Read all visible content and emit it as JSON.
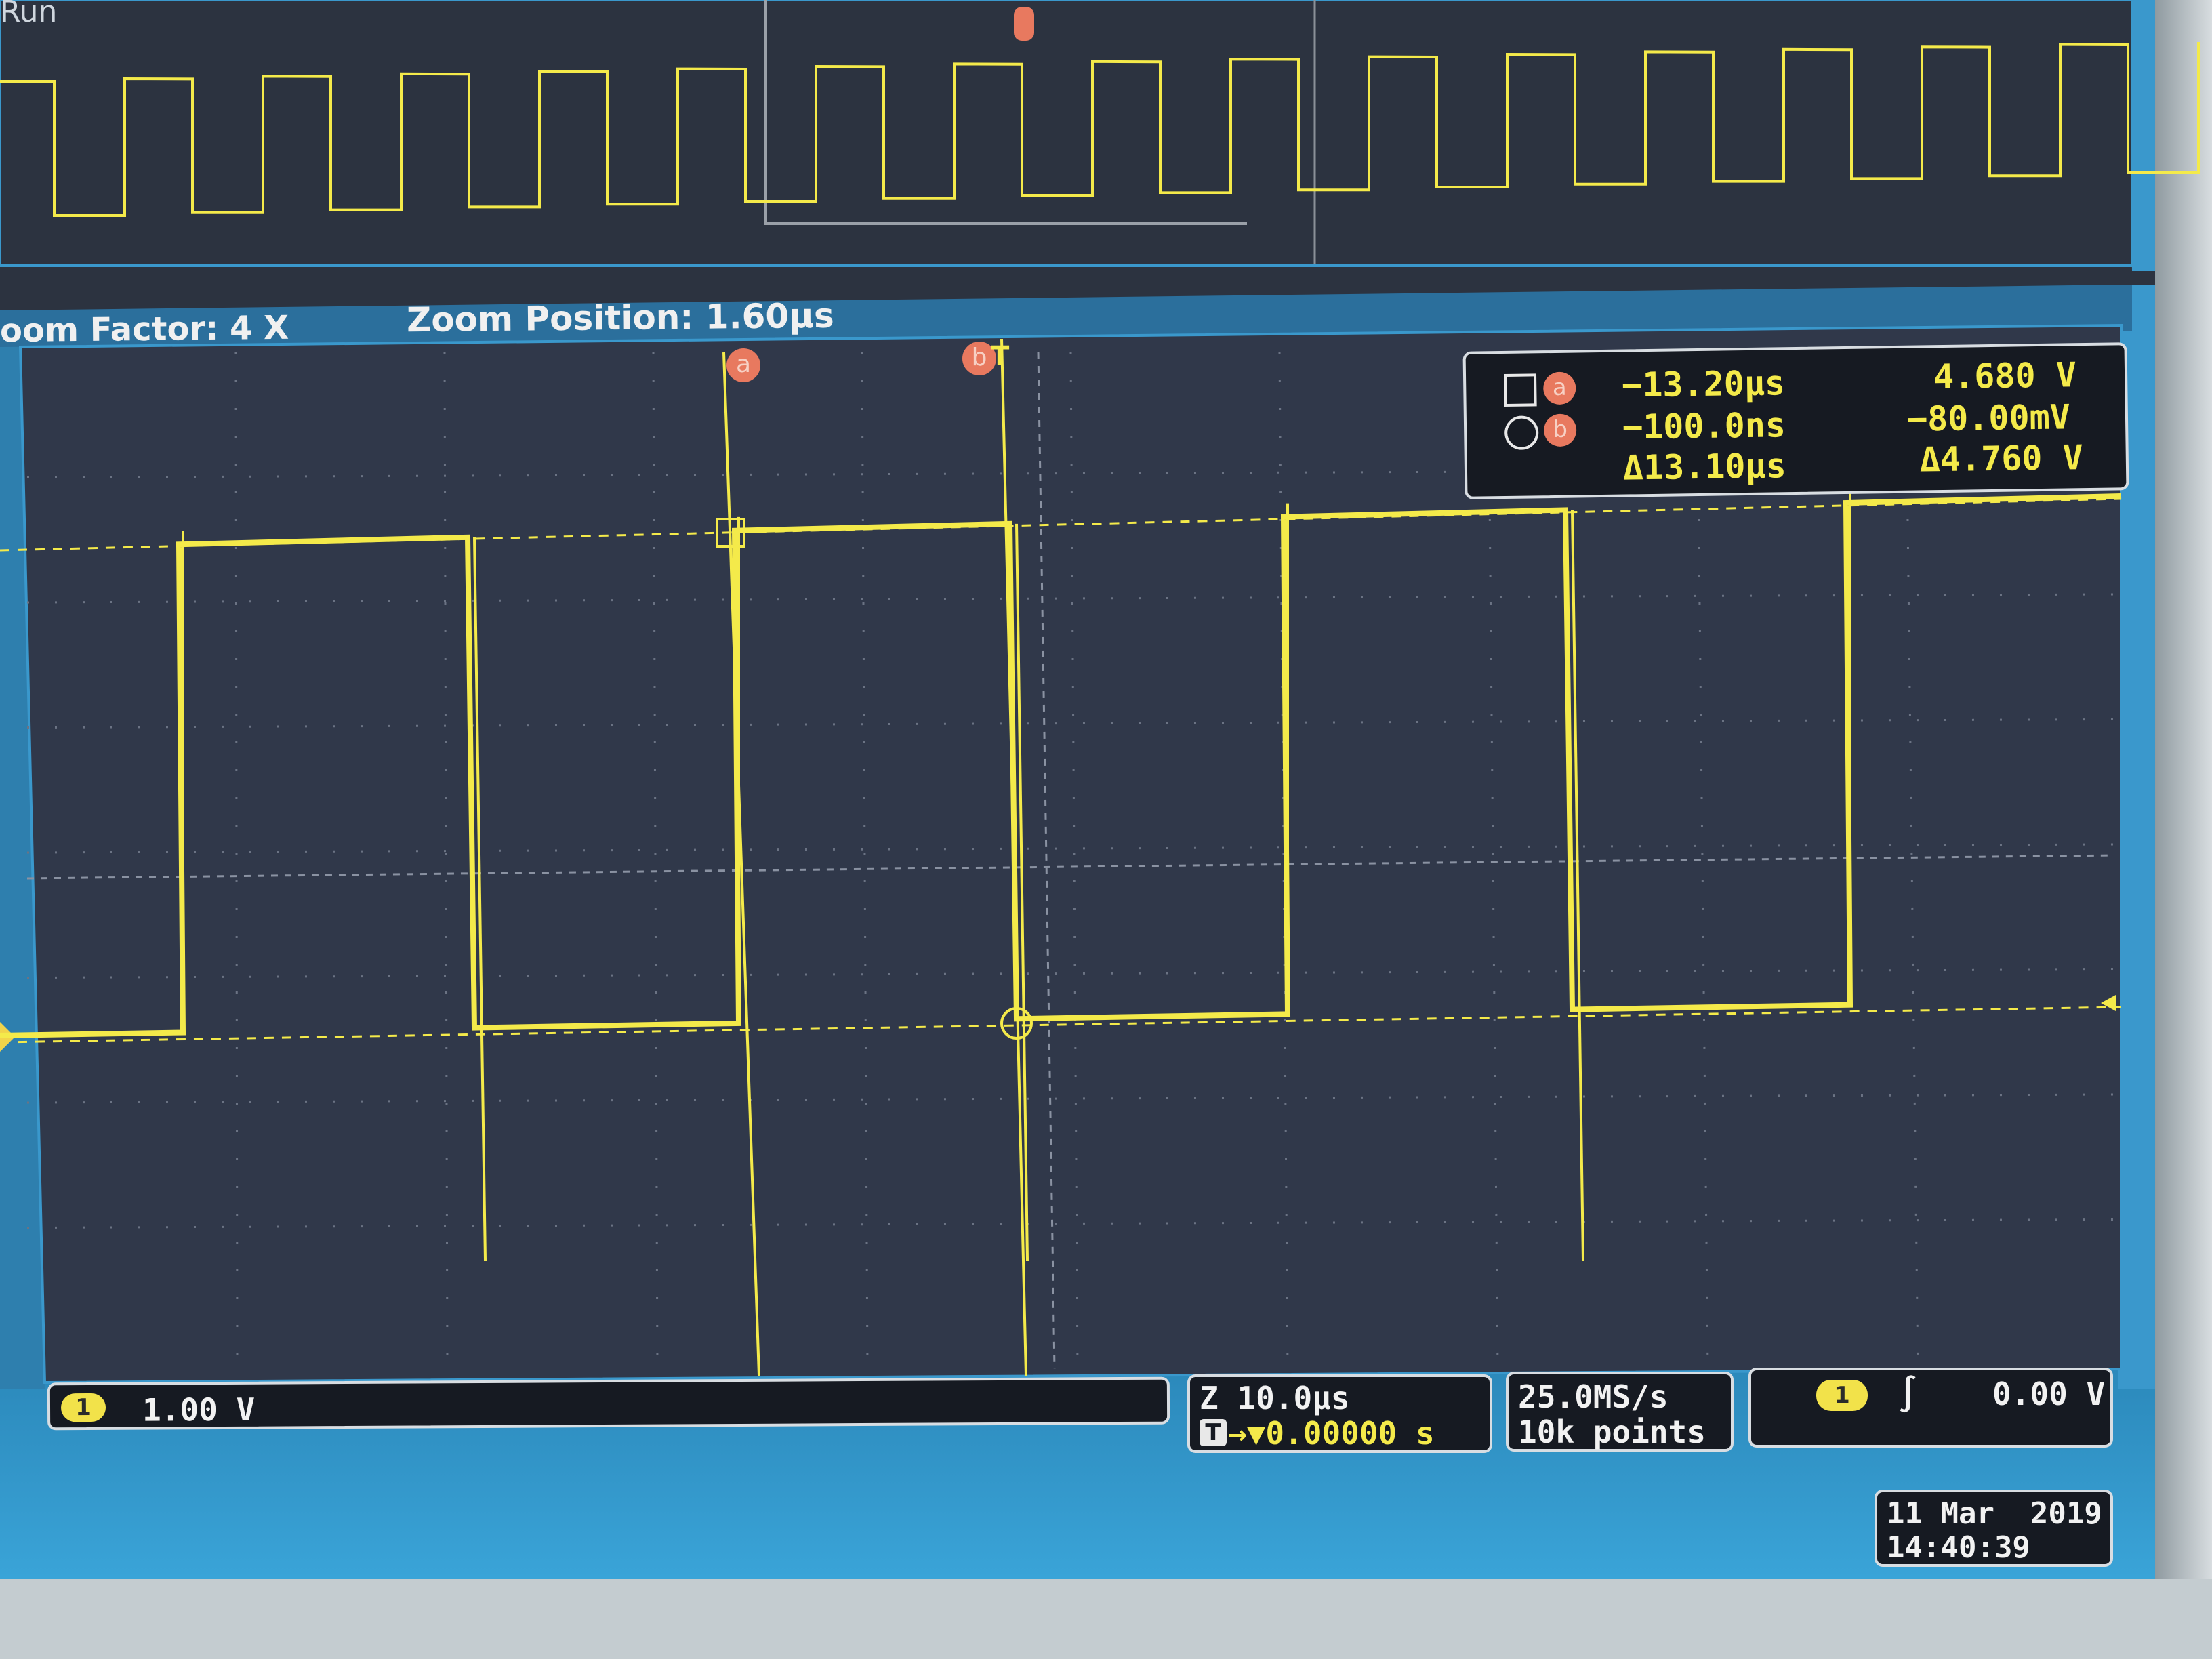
{
  "run_status": "Run",
  "zoom_bar": {
    "factor": "oom Factor: 4 X",
    "position": "Zoom Position: 1.60µs"
  },
  "cursor_labels": {
    "a": "a",
    "b": "b",
    "trigger": "T"
  },
  "cursor_readout": {
    "a_time": "−13.20µs",
    "a_volt": "4.680 V",
    "b_time": "−100.0ns",
    "b_volt": "−80.00mV",
    "delta_time": "Δ13.10µs",
    "delta_volt": "Δ4.760 V"
  },
  "channel1": {
    "badge": "1",
    "scale": "1.00 V"
  },
  "timebase": {
    "zoom_scale": "Z 10.0µs",
    "trigger_pos_icon": "T",
    "trigger_pos": "→▼0.00000 s"
  },
  "acquisition": {
    "rate": "25.0MS/s",
    "points": "10k points"
  },
  "trigger": {
    "source_badge": "1",
    "slope_icon": "rising-edge-icon",
    "slope_glyph": "∫",
    "level": "0.00 V"
  },
  "datetime": {
    "date": "11 Mar  2019",
    "time": "14:40:39"
  },
  "colors": {
    "trace": "#f4ea4a",
    "screen": "#2c3340",
    "status_bar": "#2f8fbf",
    "cursor_badge": "#e8795f",
    "panel_border": "#d8dde2"
  },
  "signal": {
    "waveform": "square",
    "high_level_V": 4.68,
    "low_level_V": -0.08,
    "vertical_scale_V_per_div": 1.0,
    "zoom_factor": 4
  }
}
